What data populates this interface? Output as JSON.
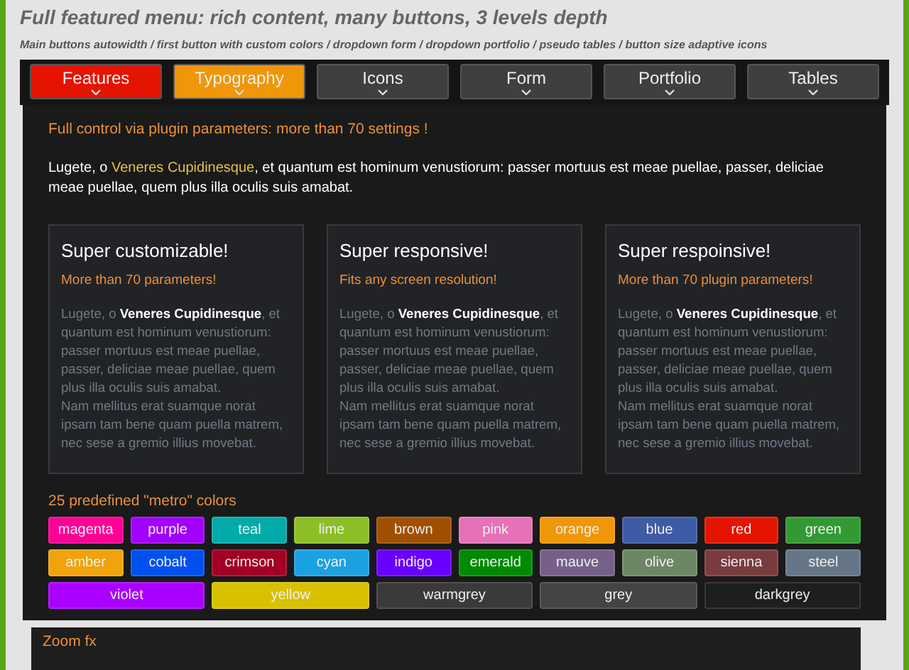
{
  "heading": "Full featured menu: rich content, many buttons, 3 levels depth",
  "subheading": "Main buttons autowidth / first button with custom colors / dropdown form / dropdown portfolio / pseudo tables / button size adaptive icons",
  "tabs": [
    {
      "label": "Features",
      "color": "#e51400"
    },
    {
      "label": "Typography",
      "color": "#f09609"
    },
    {
      "label": "Icons",
      "color": "#3f3f3f"
    },
    {
      "label": "Form",
      "color": "#3f3f3f"
    },
    {
      "label": "Portfolio",
      "color": "#3f3f3f"
    },
    {
      "label": "Tables",
      "color": "#3f3f3f"
    }
  ],
  "dropdown": {
    "intro": "Full control via plugin parameters: more than 70 settings !",
    "paragraph": [
      {
        "text": "Lugete, o ",
        "highlighted": false
      },
      {
        "text": "Veneres Cupidinesque",
        "highlighted": true
      },
      {
        "text": ", et quantum est hominum venustiorum: passer mortuus est meae puellae, passer, deliciae meae puellae, quem plus illa oculis suis amabat.",
        "highlighted": false
      }
    ],
    "cards": [
      {
        "title": "Super customizable!",
        "subtitle": "More than 70 parameters!",
        "body": [
          "Lugete, o **Veneres Cupidinesque**, et quantum est hominum venustiorum: passer mortuus est meae puellae, passer, deliciae meae puellae, quem plus illa oculis suis amabat.",
          "Nam mellitus erat suamque norat ipsam tam bene quam puella matrem, nec sese a gremio illius movebat."
        ]
      },
      {
        "title": "Super responsive!",
        "subtitle": "Fits any screen resolution!",
        "body": [
          "Lugete, o **Veneres Cupidinesque**, et quantum est hominum venustiorum: passer mortuus est meae puellae, passer, deliciae meae puellae, quem plus illa oculis suis amabat.",
          "Nam mellitus erat suamque norat ipsam tam bene quam puella matrem, nec sese a gremio illius movebat."
        ]
      },
      {
        "title": "Super respoinsive!",
        "subtitle": "More than 70 plugin parameters!",
        "body": [
          "Lugete, o **Veneres Cupidinesque**, et quantum est hominum venustiorum: passer mortuus est meae puellae, passer, deliciae meae puellae, quem plus illa oculis suis amabat.",
          "Nam mellitus erat suamque norat ipsam tam bene quam puella matrem, nec sese a gremio illius movebat."
        ]
      }
    ],
    "colors_title": "25 predefined \"metro\" colors",
    "colors": [
      {
        "label": "magenta",
        "color": "#ff0097"
      },
      {
        "label": "purple",
        "color": "#a200ff"
      },
      {
        "label": "teal",
        "color": "#00aba9"
      },
      {
        "label": "lime",
        "color": "#8cbf26"
      },
      {
        "label": "brown",
        "color": "#a05000"
      },
      {
        "label": "pink",
        "color": "#e671b8"
      },
      {
        "label": "orange",
        "color": "#f09609"
      },
      {
        "label": "blue",
        "color": "#3e5ba6"
      },
      {
        "label": "red",
        "color": "#e51400"
      },
      {
        "label": "green",
        "color": "#339933"
      },
      {
        "label": "amber",
        "color": "#f0a30a"
      },
      {
        "label": "cobalt",
        "color": "#0050ef"
      },
      {
        "label": "crimson",
        "color": "#a20025"
      },
      {
        "label": "cyan",
        "color": "#1ba1e2"
      },
      {
        "label": "indigo",
        "color": "#6a00ff"
      },
      {
        "label": "emerald",
        "color": "#008a00"
      },
      {
        "label": "mauve",
        "color": "#76608a"
      },
      {
        "label": "olive",
        "color": "#6d8764"
      },
      {
        "label": "sienna",
        "color": "#7a3b3f"
      },
      {
        "label": "steel",
        "color": "#647687"
      },
      {
        "label": "violet",
        "color": "#aa00ff"
      },
      {
        "label": "yellow",
        "color": "#d8c100"
      },
      {
        "label": "warmgrey",
        "color": "#3c3a38"
      },
      {
        "label": "grey",
        "color": "#444444"
      },
      {
        "label": "darkgrey",
        "color": "#1e1e1e"
      }
    ]
  },
  "footer_label": "Zoom fx"
}
